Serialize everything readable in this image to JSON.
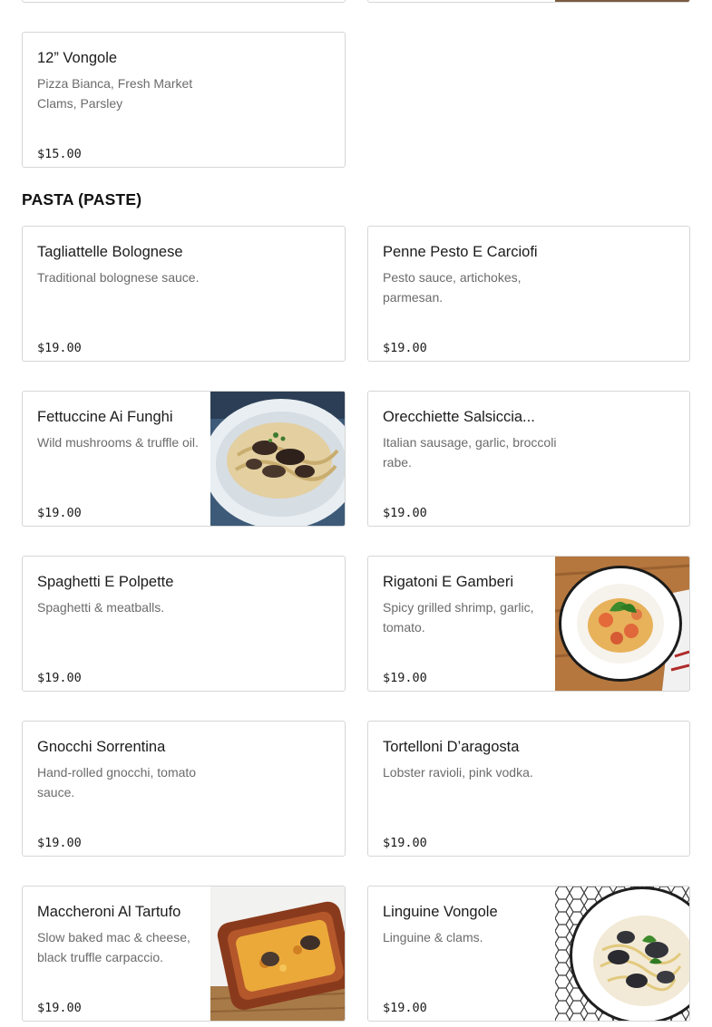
{
  "top_item": {
    "name": "12” Vongole",
    "desc": "Pizza Bianca, Fresh Market Clams, Parsley",
    "price": "$15.00"
  },
  "section": {
    "title": "PASTA (PASTE)"
  },
  "items": [
    {
      "name": "Tagliattelle Bolognese",
      "desc": "Traditional bolognese sauce.",
      "price": "$19.00"
    },
    {
      "name": "Penne Pesto E Carciofi",
      "desc": "Pesto sauce, artichokes, parmesan.",
      "price": "$19.00"
    },
    {
      "name": "Fettuccine Ai Funghi",
      "desc": "Wild mushrooms & truffle oil.",
      "price": "$19.00"
    },
    {
      "name": "Orecchiette Salsiccia...",
      "desc": "Italian sausage, garlic, broccoli rabe.",
      "price": "$19.00"
    },
    {
      "name": "Spaghetti E Polpette",
      "desc": "Spaghetti & meatballs.",
      "price": "$19.00"
    },
    {
      "name": "Rigatoni E Gamberi",
      "desc": "Spicy grilled shrimp, garlic, tomato.",
      "price": "$19.00"
    },
    {
      "name": "Gnocchi Sorrentina",
      "desc": "Hand-rolled gnocchi, tomato sauce.",
      "price": "$19.00"
    },
    {
      "name": "Tortelloni D’aragosta",
      "desc": "Lobster ravioli, pink vodka.",
      "price": "$19.00"
    },
    {
      "name": "Maccheroni Al Tartufo",
      "desc": "Slow baked mac & cheese, black truffle carpaccio.",
      "price": "$19.00"
    },
    {
      "name": "Linguine Vongole",
      "desc": "Linguine & clams.",
      "price": "$19.00"
    }
  ],
  "colors": {
    "border": "#d6d6d6",
    "desc_text": "#6b6b6b",
    "title_text": "#1c1c1c"
  }
}
